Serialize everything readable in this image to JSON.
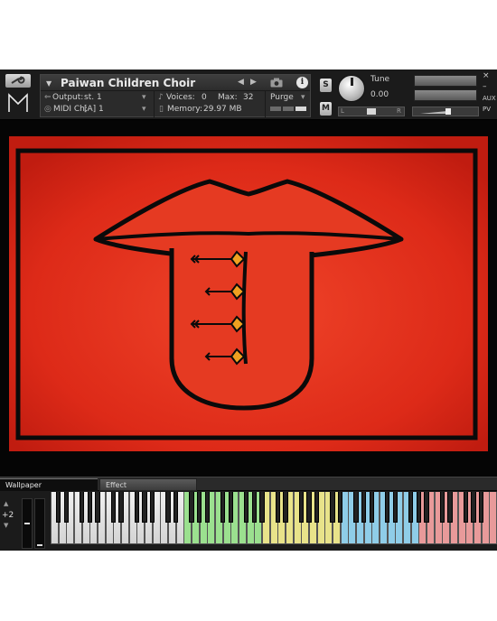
{
  "header": {
    "instrument_name": "Paiwan Children Choir",
    "output_label": "Output:",
    "output_value": "st. 1",
    "midi_label": "MIDI Ch:",
    "midi_value": "[A]  1",
    "voices_label": "Voices:",
    "voices_value": "0",
    "max_label": "Max:",
    "max_value": "32",
    "memory_label": "Memory:",
    "memory_value": "29.97 MB",
    "purge_label": "Purge",
    "info_label": "i",
    "solo_label": "S",
    "mute_label": "M",
    "tune_label": "Tune",
    "tune_value": "0.00",
    "pan_left": "L",
    "pan_center": "+|+",
    "pan_right": "R",
    "close_symbol": "×",
    "minimize_symbol": "–",
    "aux_label": "AUX",
    "pv_label": "PV"
  },
  "tabs": [
    {
      "label": "Wallpaper",
      "active": true
    },
    {
      "label": "Effect",
      "active": false
    }
  ],
  "keyboard": {
    "octave_value": "+2",
    "zone_colors": [
      "#9be08f",
      "#e8e38a",
      "#8fcde8",
      "#e89a9a"
    ],
    "zone_ranges_white_keys": [
      [
        17,
        27
      ],
      [
        27,
        37
      ],
      [
        37,
        47
      ],
      [
        47,
        57
      ]
    ]
  },
  "artwork": {
    "background_color": "#e8281a",
    "outline_color": "#0a0a0a",
    "accent_color": "#f0a020"
  }
}
